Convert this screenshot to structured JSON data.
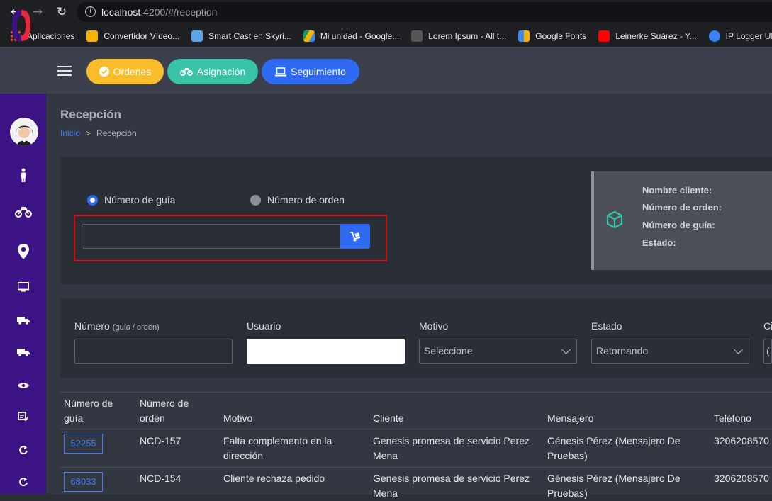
{
  "browser": {
    "url_host": "localhost",
    "url_rest": ":4200/#/reception",
    "bookmarks": [
      {
        "label": "Aplicaciones",
        "color": "#ea4335"
      },
      {
        "label": "Convertidor Vídeo...",
        "color": "#f4b400"
      },
      {
        "label": "Smart Cast en Skyri...",
        "color": "#5ba4e6"
      },
      {
        "label": "Mi unidad - Google...",
        "color": "#0f9d58"
      },
      {
        "label": "Lorem Ipsum - All t...",
        "color": "#999999"
      },
      {
        "label": "Google Fonts",
        "color": "#4285f4"
      },
      {
        "label": "Leinerke Suárez - Y...",
        "color": "#ff0000"
      },
      {
        "label": "IP Logger URL S",
        "color": "#3b82f6"
      }
    ]
  },
  "header": {
    "buttons": {
      "ordenes": "Ordenes",
      "asignacion": "Asignación",
      "seguimiento": "Seguimiento"
    }
  },
  "page": {
    "title": "Recepción",
    "breadcrumb_home": "Inicio",
    "breadcrumb_sep": ">",
    "breadcrumb_current": "Recepción"
  },
  "search": {
    "radio_guide": "Número de guía",
    "radio_order": "Número de orden",
    "input_value": ""
  },
  "info": {
    "client": "Nombre cliente:",
    "order": "Número de orden:",
    "guide": "Número de guía:",
    "state": "Estado:"
  },
  "filters": {
    "numero_label": "Número",
    "numero_hint": "(guía / orden)",
    "usuario_label": "Usuario",
    "motivo_label": "Motivo",
    "motivo_value": "Seleccione",
    "estado_label": "Estado",
    "estado_value": "Retornando",
    "next_label": "Ci",
    "next_value": "("
  },
  "table": {
    "headers": {
      "guia_1": "Número de",
      "guia_2": "guía",
      "orden_1": "Número de",
      "orden_2": "orden",
      "motivo": "Motivo",
      "cliente": "Cliente",
      "mensajero": "Mensajero",
      "telefono": "Teléfono"
    },
    "rows": [
      {
        "guia": "52255",
        "orden": "NCD-157",
        "motivo_1": "Falta complemento en la",
        "motivo_2": "dirección",
        "cliente_1": "Genesis promesa de servicio Perez",
        "cliente_2": "Mena",
        "mensajero_1": "Génesis Pérez (Mensajero De",
        "mensajero_2": "Pruebas)",
        "telefono": "3206208570"
      },
      {
        "guia": "68033",
        "orden": "NCD-154",
        "motivo_1": "Cliente rechaza pedido",
        "motivo_2": "",
        "cliente_1": "Genesis promesa de servicio Perez",
        "cliente_2": "Mena",
        "mensajero_1": "Génesis Pérez (Mensajero De",
        "mensajero_2": "Pruebas)",
        "telefono": "3206208570"
      }
    ]
  }
}
